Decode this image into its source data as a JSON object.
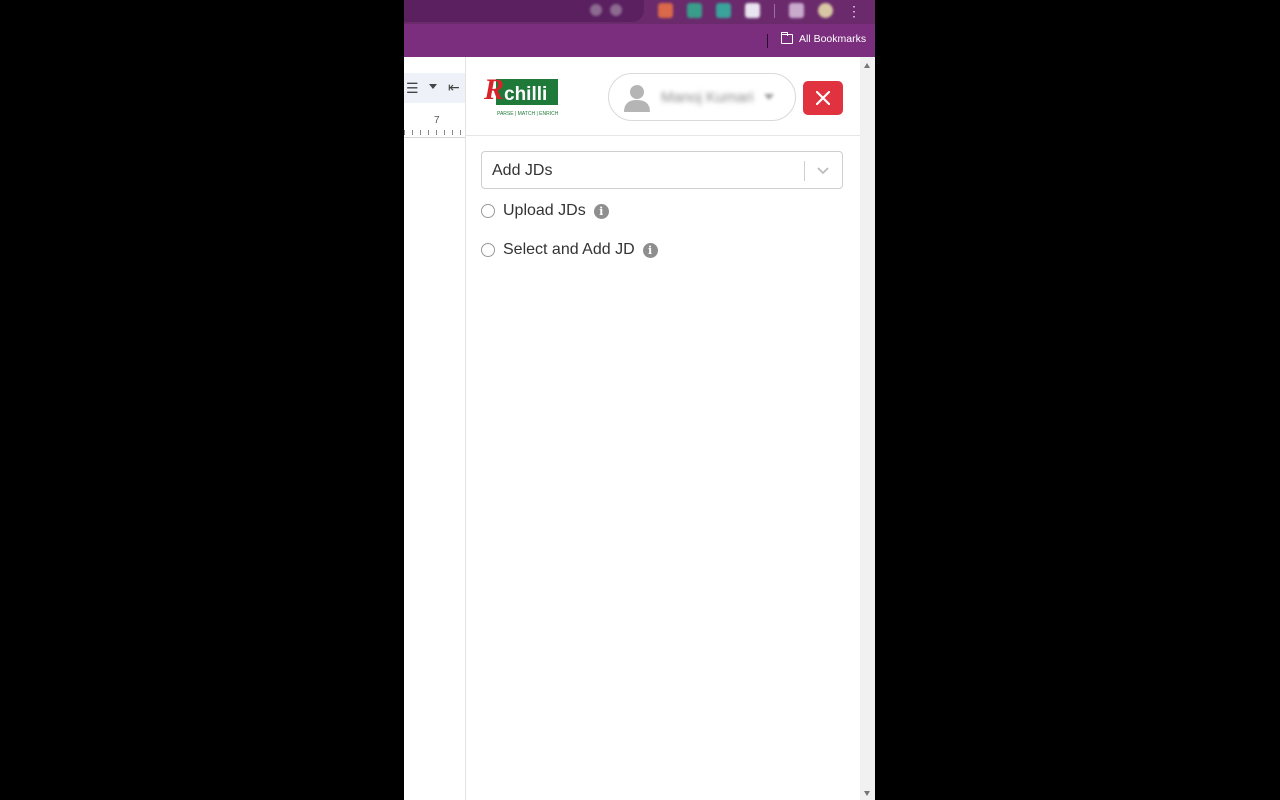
{
  "browser": {
    "bookmarks_bar": {
      "all_bookmarks_label": "All Bookmarks"
    },
    "extension_colors": [
      "#d9694a",
      "#3a9d8a",
      "#3aa39a",
      "#e9e4ef",
      "#c9a9cc",
      "#d8c7a4"
    ]
  },
  "doc": {
    "ruler_number": "7"
  },
  "panel": {
    "logo": {
      "brand": "chilli",
      "brand_initial": "R",
      "tagline": "PARSE | MATCH | ENRICH"
    },
    "user": {
      "name": "Manoj Kumari"
    },
    "close_symbol": "✕",
    "select": {
      "value": "Add JDs"
    },
    "options": [
      {
        "label": "Upload JDs",
        "info": "i"
      },
      {
        "label": "Select and Add JD",
        "info": "i"
      }
    ]
  },
  "colors": {
    "close_red": "#e0323f",
    "brand_green": "#1f7a3a",
    "brand_red": "#d8232a",
    "chrome_purple": "#7b2d7e"
  }
}
